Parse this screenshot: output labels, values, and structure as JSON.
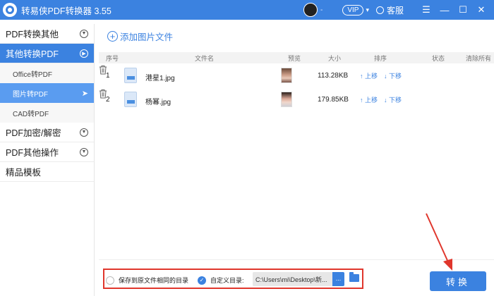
{
  "app": {
    "title": "转易侠PDF转换器 3.55",
    "user_name": "-",
    "vip": "VIP",
    "vip_caret": "▾",
    "service": "客服",
    "menu_glyph": "☰",
    "minimize_glyph": "—",
    "maximize_glyph": "☐",
    "close_glyph": "✕"
  },
  "sidebar": {
    "groups": [
      {
        "label": "PDF转换其他",
        "active": false
      },
      {
        "label": "其他转换PDF",
        "active": true
      }
    ],
    "subitems": [
      {
        "label": "Office转PDF"
      },
      {
        "label": "图片转PDF",
        "selected": true
      },
      {
        "label": "CAD转PDF"
      }
    ],
    "groups_after": [
      {
        "label": "PDF加密/解密"
      },
      {
        "label": "PDF其他操作"
      },
      {
        "label": "精品模板"
      }
    ]
  },
  "toolbar": {
    "add_label": "添加图片文件",
    "add_glyph": "+"
  },
  "table": {
    "headers": {
      "index": "序号",
      "filename": "文件名",
      "preview": "预览",
      "size": "大小",
      "order": "排序",
      "status": "状态",
      "clear": "清除所有"
    },
    "rows": [
      {
        "index": "1",
        "name": "港星1.jpg",
        "size": "113.28KB",
        "up": "↑ 上移",
        "down": "↓ 下移",
        "status": ""
      },
      {
        "index": "2",
        "name": "杨幂.jpg",
        "size": "179.85KB",
        "up": "↑ 上移",
        "down": "↓ 下移",
        "status": ""
      }
    ]
  },
  "bottom": {
    "option_same_dir": "保存到原文件相同的目录",
    "option_custom": "自定义目录:",
    "checked_glyph": "✓",
    "path_value": "C:\\Users\\mi\\Desktop\\新...",
    "browse_label": "...",
    "convert_label": "转换"
  },
  "colors": {
    "accent": "#3b82e0",
    "highlight": "#e0362c"
  }
}
